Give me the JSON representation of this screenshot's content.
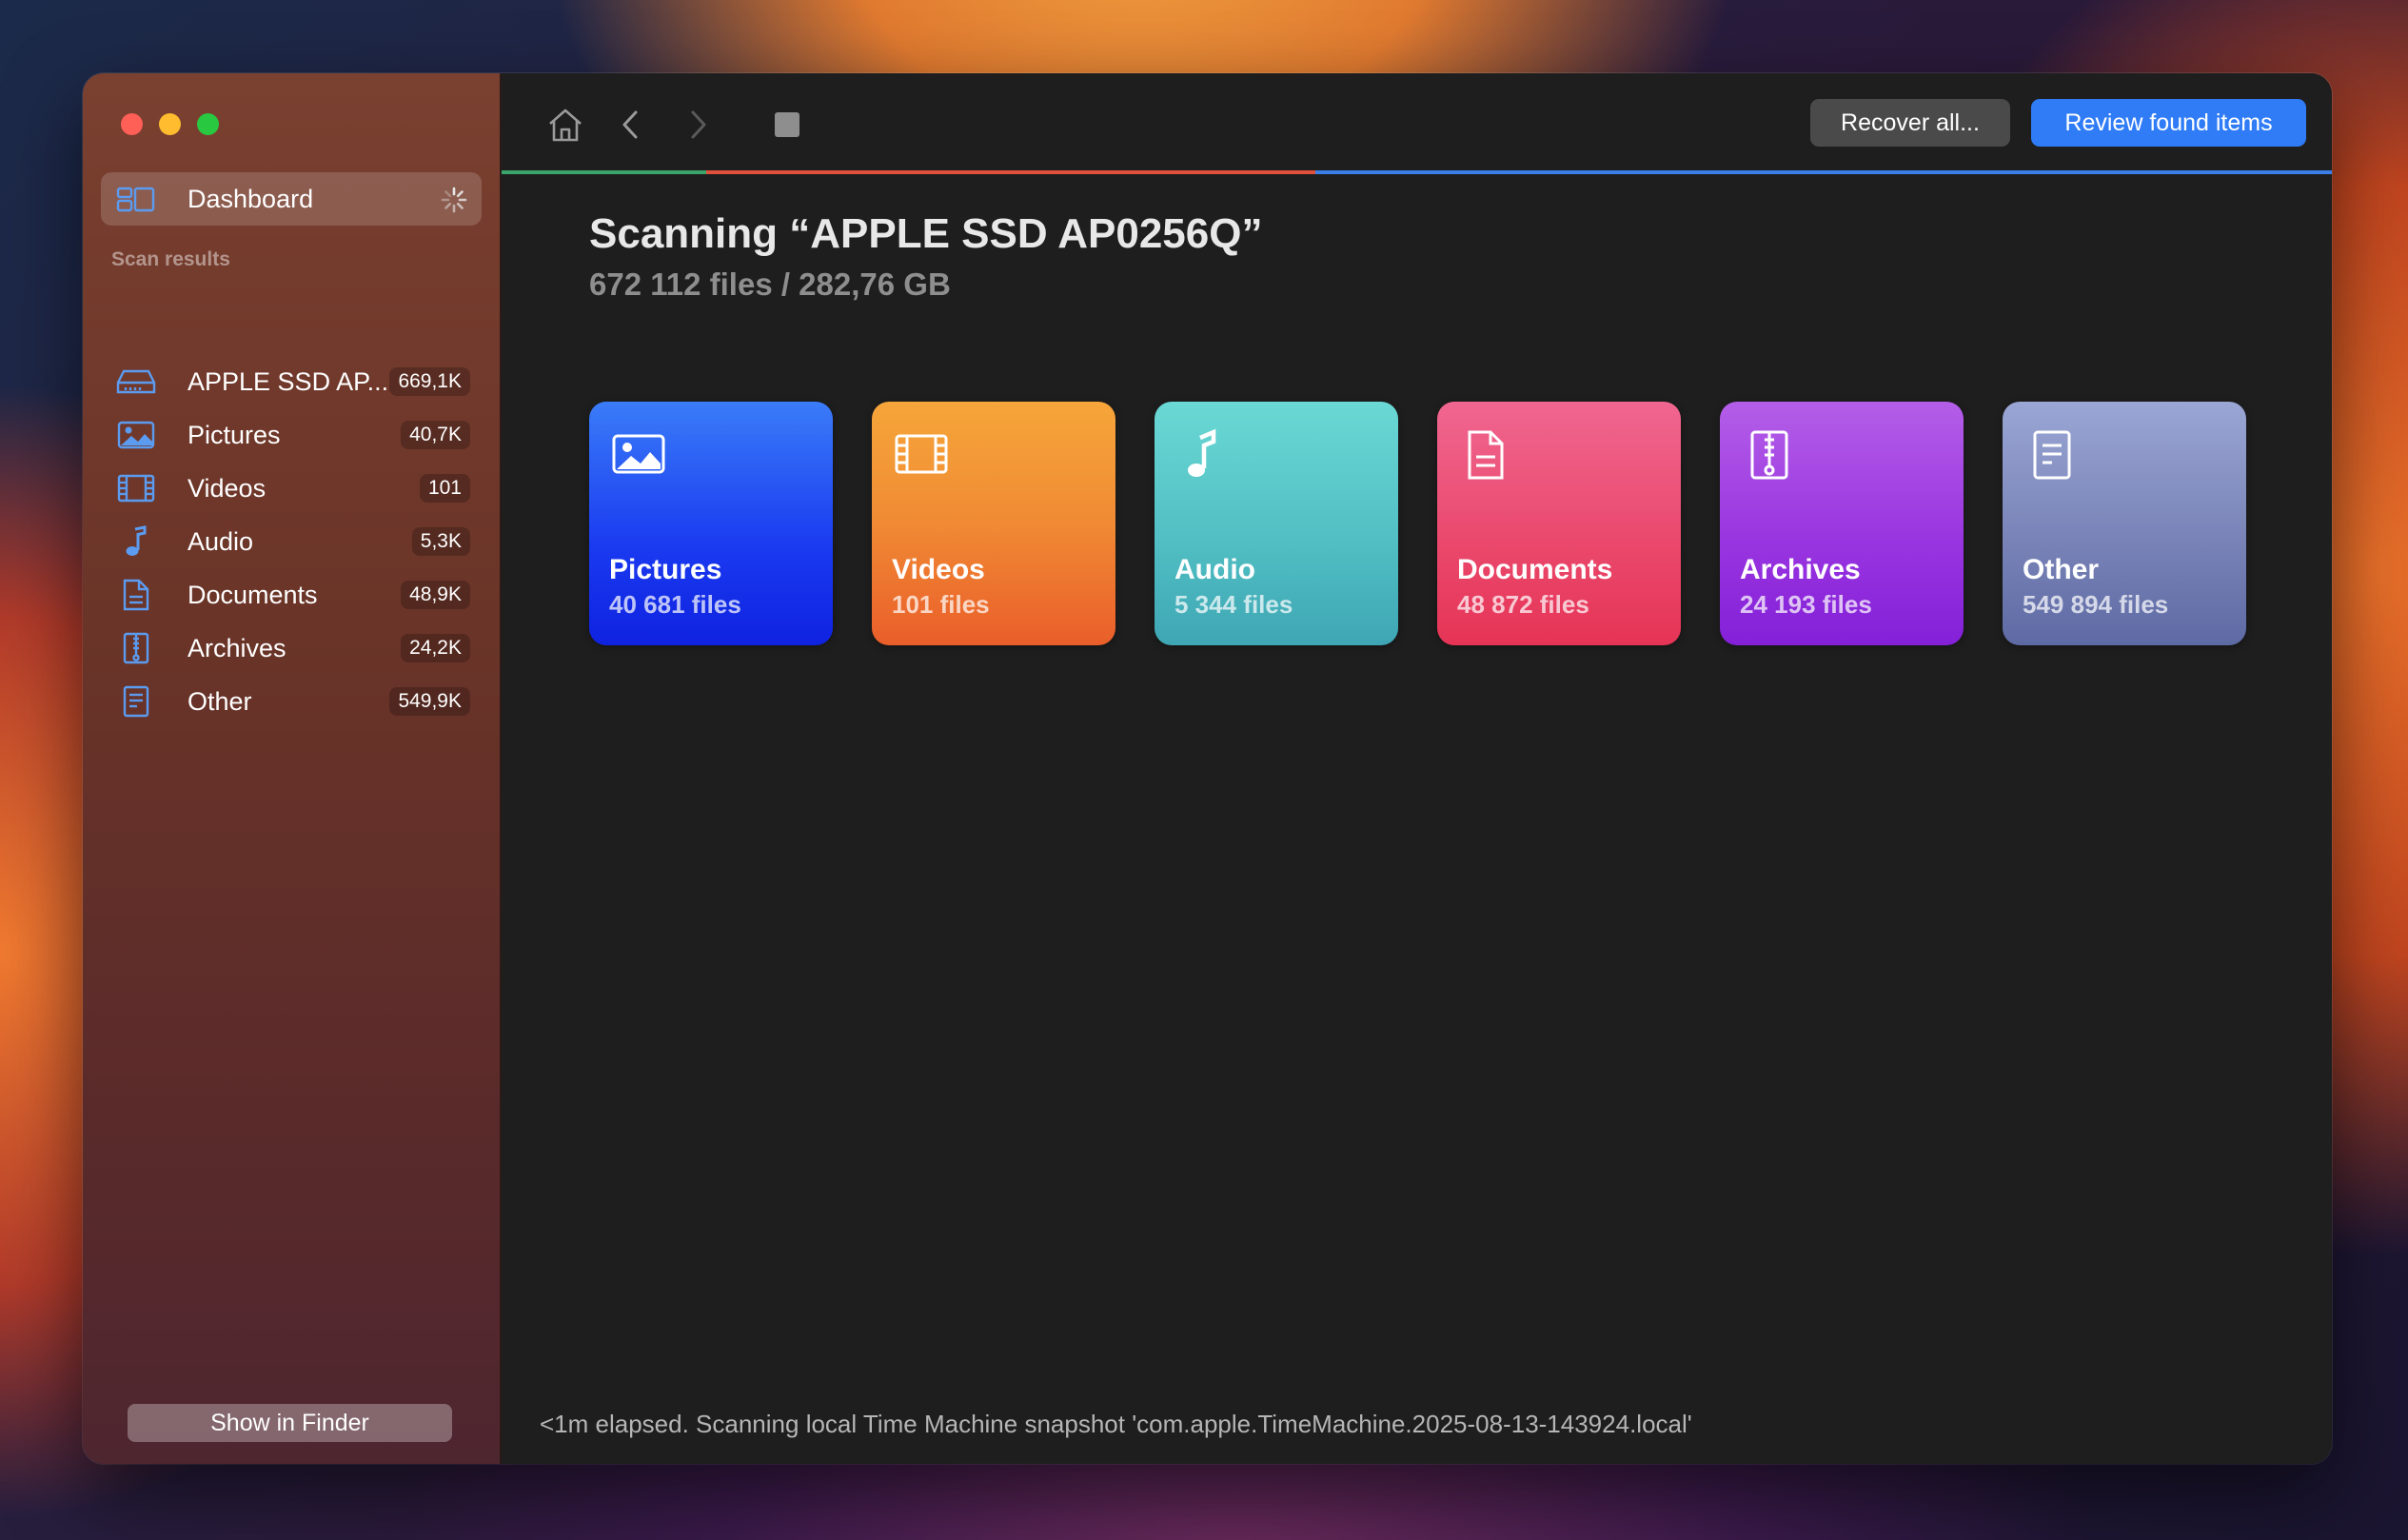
{
  "sidebar": {
    "dashboard_label": "Dashboard",
    "section_label": "Scan results",
    "items": [
      {
        "label": "APPLE SSD AP...",
        "count": "669,1K",
        "icon": "drive-icon"
      },
      {
        "label": "Pictures",
        "count": "40,7K",
        "icon": "picture-icon"
      },
      {
        "label": "Videos",
        "count": "101",
        "icon": "film-icon"
      },
      {
        "label": "Audio",
        "count": "5,3K",
        "icon": "music-note-icon"
      },
      {
        "label": "Documents",
        "count": "48,9K",
        "icon": "document-icon"
      },
      {
        "label": "Archives",
        "count": "24,2K",
        "icon": "archive-icon"
      },
      {
        "label": "Other",
        "count": "549,9K",
        "icon": "other-file-icon"
      }
    ],
    "show_in_finder_label": "Show in Finder"
  },
  "toolbar": {
    "recover_label": "Recover all...",
    "review_label": "Review found items"
  },
  "main": {
    "title": "Scanning “APPLE SSD AP0256Q”",
    "subtitle": "672 112 files / 282,76 GB",
    "cards": [
      {
        "name": "Pictures",
        "count": "40 681 files",
        "icon": "picture-icon"
      },
      {
        "name": "Videos",
        "count": "101 files",
        "icon": "film-icon"
      },
      {
        "name": "Audio",
        "count": "5 344 files",
        "icon": "music-note-icon"
      },
      {
        "name": "Documents",
        "count": "48 872 files",
        "icon": "document-icon"
      },
      {
        "name": "Archives",
        "count": "24 193 files",
        "icon": "archive-icon"
      },
      {
        "name": "Other",
        "count": "549 894 files",
        "icon": "other-file-icon"
      }
    ],
    "status": "<1m elapsed. Scanning local Time Machine snapshot 'com.apple.TimeMachine.2025-08-13-143924.local'"
  },
  "colors": {
    "accent": "#2f7cf6",
    "pictures": "#1a3af0",
    "videos": "#ee7030",
    "audio": "#52c0c4",
    "documents": "#ea4a6e",
    "archives": "#9a2ee0",
    "other": "#7a84b8"
  }
}
